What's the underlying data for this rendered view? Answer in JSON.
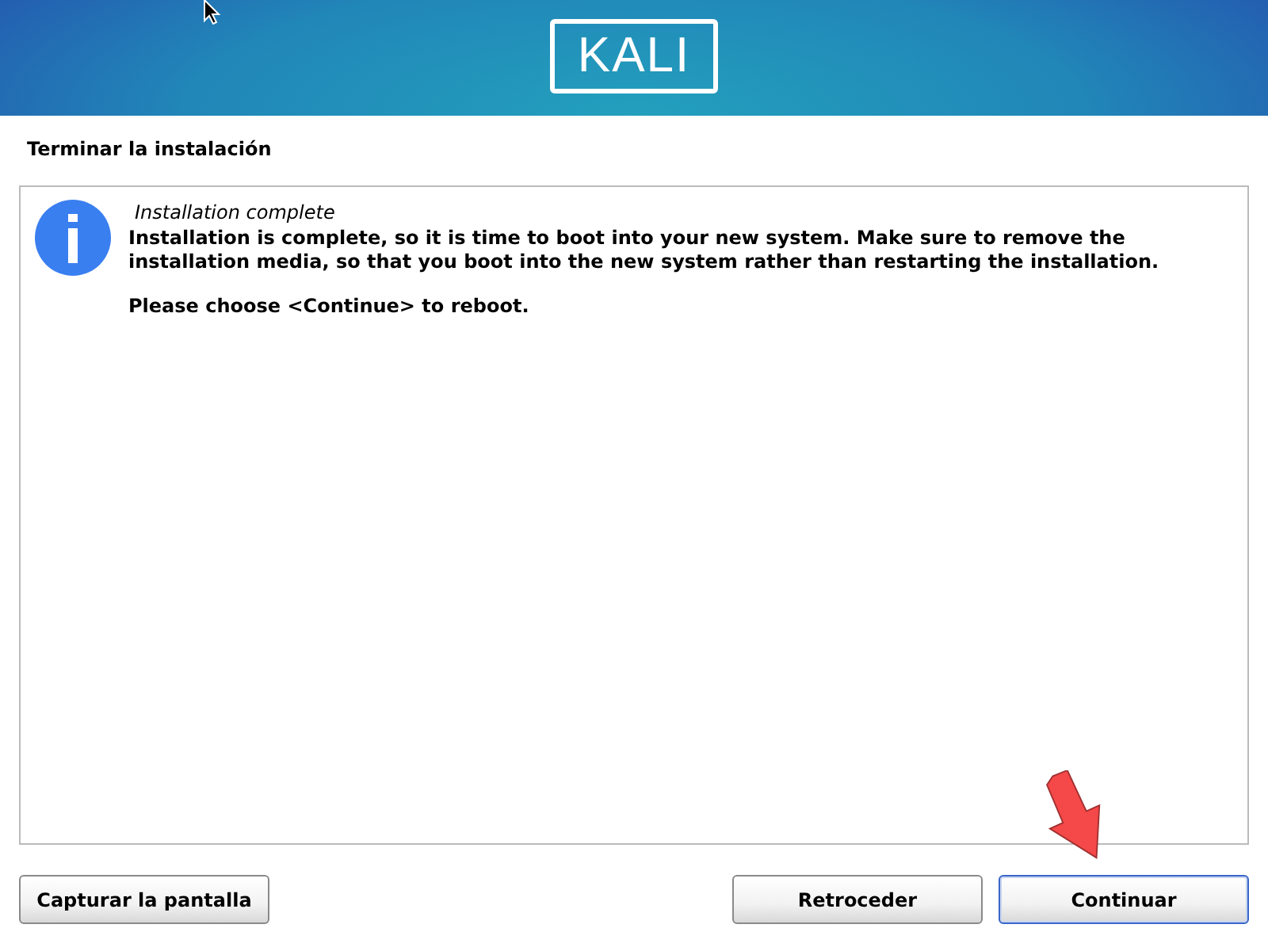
{
  "banner": {
    "logo": "KALI"
  },
  "page_title": "Terminar la instalación",
  "message": {
    "title": "Installation complete",
    "paragraphs": [
      "Installation is complete, so it is time to boot into your new system. Make sure to remove the installation media, so that you boot into the new system rather than restarting the installation.",
      "Please choose <Continue> to reboot."
    ]
  },
  "buttons_left": [
    {
      "label": "Capturar la pantalla",
      "focused": false
    }
  ],
  "buttons_right": [
    {
      "label": "Retroceder",
      "focused": false
    },
    {
      "label": "Continuar",
      "focused": true
    }
  ]
}
